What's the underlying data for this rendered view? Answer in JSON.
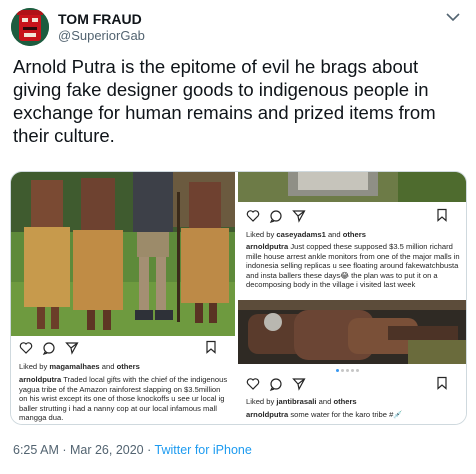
{
  "author": {
    "name": "TOM FRAUD",
    "handle": "@SuperiorGab"
  },
  "tweet_text": "Arnold Putra is the epitome of evil he brags about giving fake designer goods to indigenous people in exchange for human remains and prized items from their culture.",
  "posts": {
    "left": {
      "liked_by": "magamalhaes",
      "others": "others",
      "username": "arnoldputra",
      "caption": "Traded local gifts with the chief of the indigenous yagua tribe of the Amazon rainforest slapping on $3.5million on his wrist except its one of those knockoffs u see ur local ig baller strutting i had a nanny cop at our local infamous mall mangga dua."
    },
    "right_top": {
      "liked_by": "caseyadams1",
      "others": "others",
      "username": "arnoldputra",
      "caption": "Just copped these supposed $3.5 million richard mille house arrest ankle monitors from one of the major malls in indonesia selling replicas u see floating around fakewatchbusta and insta ballers these days😂 the plan was to put it on a decomposing body in the village i visited last week"
    },
    "right_bottom": {
      "liked_by": "jantibrasali",
      "others": "others",
      "username": "arnoldputra",
      "caption": "some water for the karo tribe #💉"
    },
    "liked_prefix": "Liked by",
    "and_word": "and"
  },
  "footer": {
    "time": "6:25 AM · Mar 26, 2020",
    "separator": " · ",
    "source": "Twitter for iPhone"
  },
  "icons": [
    "avatar",
    "more-icon",
    "heart-icon",
    "comment-icon",
    "share-icon",
    "bookmark-icon"
  ],
  "colors": {
    "text": "#0f1419",
    "secondary": "#536471",
    "link": "#1d9bf0"
  }
}
